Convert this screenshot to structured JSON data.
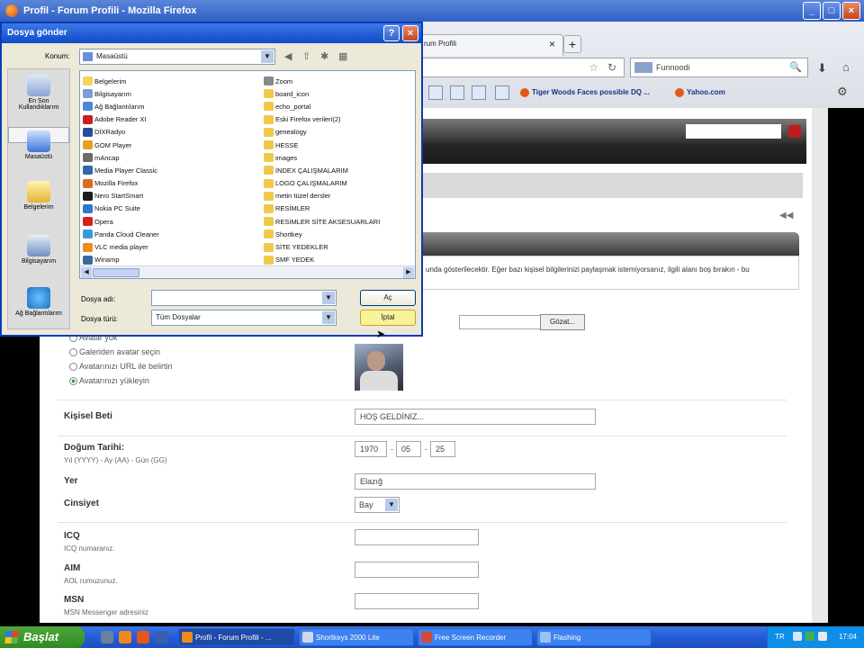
{
  "firefox": {
    "title": "Profil - Forum Profili - Mozilla Firefox",
    "tab_label": "rum Profili",
    "new_tab": "+",
    "search_engine_text": "Funnoodi",
    "bookmarks": [
      "Tiger Woods Faces possible DQ ...",
      "Yahoo.com"
    ]
  },
  "dialog": {
    "title": "Dosya gönder",
    "look_in_label": "Konum:",
    "look_in_value": "Masaüstü",
    "places": [
      "En Son Kullandıklarım",
      "Masaüstü",
      "Belgelerim",
      "Bilgisayarım",
      "Ağ Bağlantılarım"
    ],
    "files_col1": [
      "Belgelerim",
      "Bilgisayarım",
      "Ağ Bağlantılarım",
      "Adobe Reader XI",
      "DİXRadyo",
      "GOM Player",
      "mAncap",
      "Media Player Classic",
      "Mozilla Firefox",
      "Nero StartSmart",
      "Nokia PC Suite",
      "Opera",
      "Panda Cloud Cleaner",
      "VLC media player",
      "Winamp"
    ],
    "files_col2": [
      "Zoom",
      "board_icon",
      "echo_portal",
      "Eski Firefox verileri(2)",
      "genealogy",
      "HESSE",
      "images",
      "İNDEX ÇALIŞMALARIM",
      "LOGO ÇALIŞMALARIM",
      "metin tüzel dersler",
      "RESİMLER",
      "RESİMLER SİTE AKSESUARLARI",
      "Shortkey",
      "SİTE YEDEKLER",
      "SMF YEDEK"
    ],
    "filename_label": "Dosya adı:",
    "filename_value": "",
    "filetype_label": "Dosya türü:",
    "filetype_value": "Tüm Dosyalar",
    "open_button": "Aç",
    "cancel_button": "İptal"
  },
  "page": {
    "info_text": "unda gösterilecektir. Eğer bazı kişisel bilgilerinizi paylaşmak istemiyorsanız, ilgili alanı boş bırakın - bu",
    "browse_button": "Gözat...",
    "avatar_options": [
      "Avatar yok",
      "Galeriden avatar seçin",
      "Avatarınızı URL ile belirtin",
      "Avatarınızı yükleyin"
    ],
    "personal_text_label": "Kişisel Beti",
    "personal_text_value": "HOŞ GELDİNİZ...",
    "birthdate_label": "Doğum Tarihi:",
    "birthdate_hint": "Yıl (YYYY) - Ay (AA) - Gün (GG)",
    "birth_year": "1970",
    "birth_month": "05",
    "birth_day": "25",
    "date_sep": "-",
    "location_label": "Yer",
    "location_value": "Elazığ",
    "gender_label": "Cinsiyet",
    "gender_value": "Bay",
    "icq_label": "ICQ",
    "icq_hint": "ICQ numaranız.",
    "aim_label": "AIM",
    "aim_hint": "AOL rumuzunuz.",
    "msn_label": "MSN",
    "msn_hint": "MSN Messenger adresiniz"
  },
  "taskbar": {
    "start_label": "Başlat",
    "tasks": [
      "Profil - Forum Profili - ...",
      "Shortkeys 2000 Lite",
      "Free Screen Recorder",
      "Flashing"
    ],
    "language": "TR",
    "clock": "17:04"
  }
}
